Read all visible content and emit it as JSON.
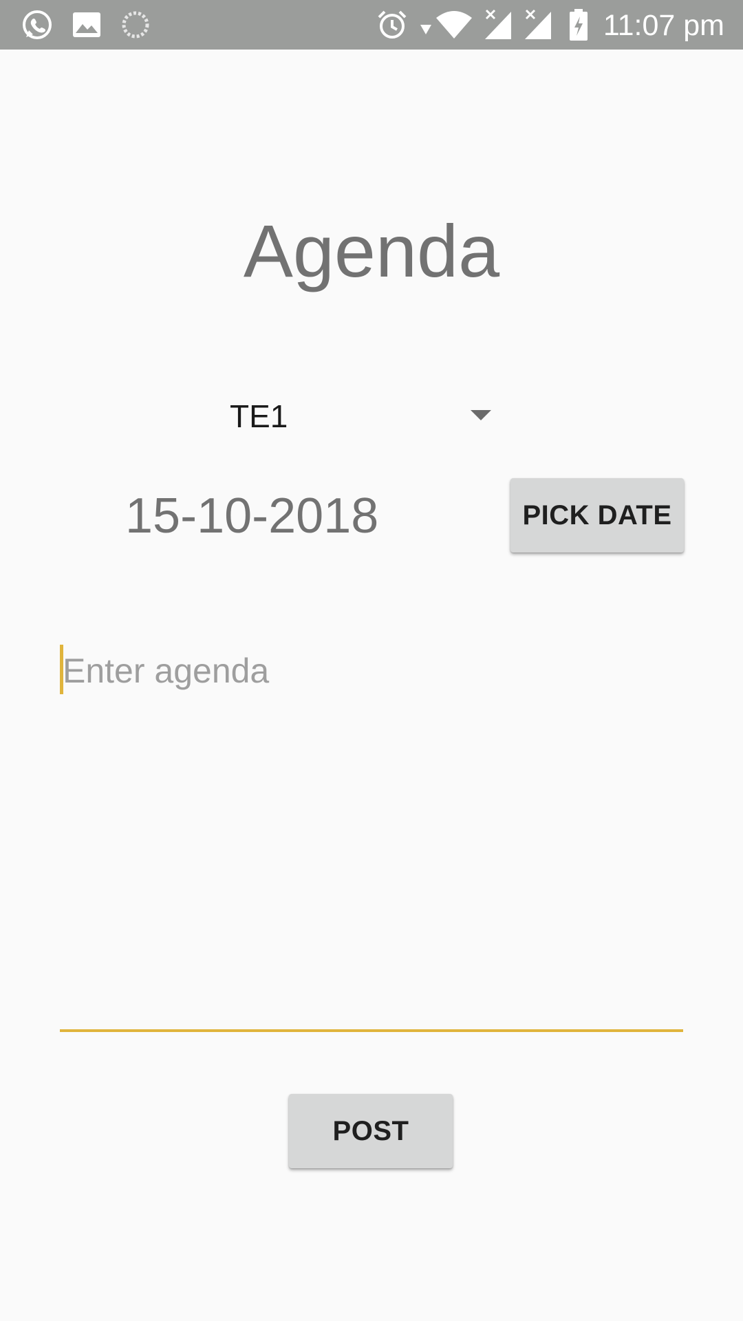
{
  "status_bar": {
    "time": "11:07 pm",
    "icons": [
      "whatsapp-icon",
      "gallery-icon",
      "sync-icon",
      "alarm-icon",
      "wifi-icon",
      "signal-icon",
      "signal-icon",
      "battery-charging-icon"
    ]
  },
  "page": {
    "title": "Agenda"
  },
  "spinner": {
    "selected": "TE1"
  },
  "date": {
    "value": "15-10-2018",
    "pick_label": "PICK DATE"
  },
  "agenda_input": {
    "placeholder": "Enter agenda",
    "value": ""
  },
  "actions": {
    "post_label": "POST"
  },
  "colors": {
    "accent": "#e0b43c",
    "status_bar": "#9b9d9b",
    "button": "#d6d7d7",
    "background": "#fafafa"
  }
}
